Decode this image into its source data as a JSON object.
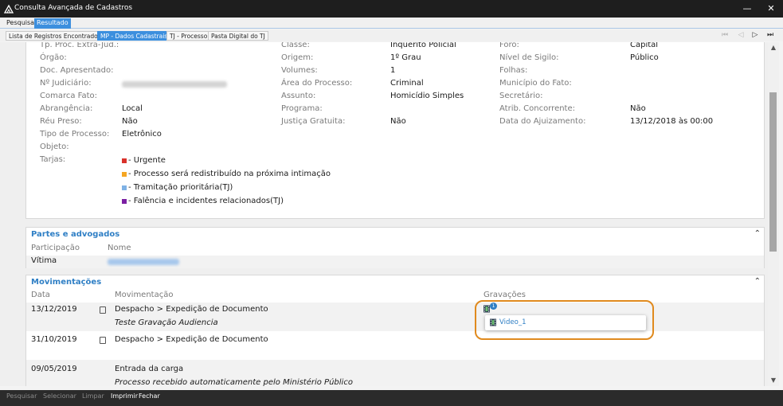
{
  "window": {
    "title": "Consulta Avançada de Cadastros"
  },
  "top_tabs": [
    "Pesquisa",
    "Resultado"
  ],
  "sub_tabs": [
    "Lista de Registros Encontrados",
    "MP - Dados Cadastrais",
    "TJ - Processo",
    "Pasta Digital do TJ"
  ],
  "fields": {
    "col1": [
      {
        "label": "Tp. Proc. Extra-Jud.:",
        "value": ""
      },
      {
        "label": "Órgão:",
        "value": ""
      },
      {
        "label": "Doc. Apresentado:",
        "value": ""
      },
      {
        "label": "Nº Judiciário:",
        "value": ""
      },
      {
        "label": "Comarca Fato:",
        "value": ""
      },
      {
        "label": "Abrangência:",
        "value": "Local"
      },
      {
        "label": "Réu Preso:",
        "value": "Não"
      },
      {
        "label": "Tipo de Processo:",
        "value": "Eletrônico"
      },
      {
        "label": "Objeto:",
        "value": ""
      },
      {
        "label": "Tarjas:",
        "value": ""
      }
    ],
    "col2": [
      {
        "label": "Classe:",
        "value": "Inquérito Policial"
      },
      {
        "label": "Origem:",
        "value": "1º Grau"
      },
      {
        "label": "Volumes:",
        "value": "1"
      },
      {
        "label": "Área do Processo:",
        "value": "Criminal"
      },
      {
        "label": "Assunto:",
        "value": "Homicídio Simples"
      },
      {
        "label": "Programa:",
        "value": ""
      },
      {
        "label": "Justiça Gratuita:",
        "value": "Não"
      }
    ],
    "col3": [
      {
        "label": "Foro:",
        "value": "Capital"
      },
      {
        "label": "Nível de Sigilo:",
        "value": "Público"
      },
      {
        "label": "Folhas:",
        "value": ""
      },
      {
        "label": "Município do Fato:",
        "value": ""
      },
      {
        "label": "Secretário:",
        "value": ""
      },
      {
        "label": "Atrib. Concorrente:",
        "value": "Não"
      },
      {
        "label": "Data do Ajuizamento:",
        "value": "13/12/2018 às 00:00"
      }
    ]
  },
  "tarjas": [
    {
      "text": "- Urgente",
      "color": "#d9322b"
    },
    {
      "text": "- Processo será redistribuído na próxima intimação",
      "color": "#f5a623"
    },
    {
      "text": "- Tramitação prioritária(TJ)",
      "color": "#7fb2e5"
    },
    {
      "text": "- Falência e incidentes relacionados(TJ)",
      "color": "#7b1fa2"
    }
  ],
  "partes": {
    "title": "Partes e advogados",
    "headers": [
      "Participação",
      "Nome"
    ],
    "rows": [
      {
        "participacao": "Vítima",
        "nome": ""
      }
    ]
  },
  "movimentacoes": {
    "title": "Movimentações",
    "headers": [
      "Data",
      "Movimentação",
      "Gravações"
    ],
    "rows": [
      {
        "data": "13/12/2019",
        "mov": "Despacho > Expedição de Documento",
        "detail": "Teste Gravação Audiencia"
      },
      {
        "data": "31/10/2019",
        "mov": "Despacho > Expedição de Documento",
        "detail": ""
      },
      {
        "data": "09/05/2019",
        "mov": "Entrada da carga",
        "detail": "Processo recebido automaticamente pelo Ministério Público"
      }
    ]
  },
  "gravacoes_popup": {
    "badge": "1",
    "item": "Video_1"
  },
  "bottom_bar": [
    "Pesquisar",
    "Selecionar",
    "Limpar",
    "Imprimir",
    "Fechar"
  ],
  "colors": {
    "accent": "#3c8fde",
    "section_title": "#2f7fc5",
    "highlight": "#e08a1e"
  }
}
